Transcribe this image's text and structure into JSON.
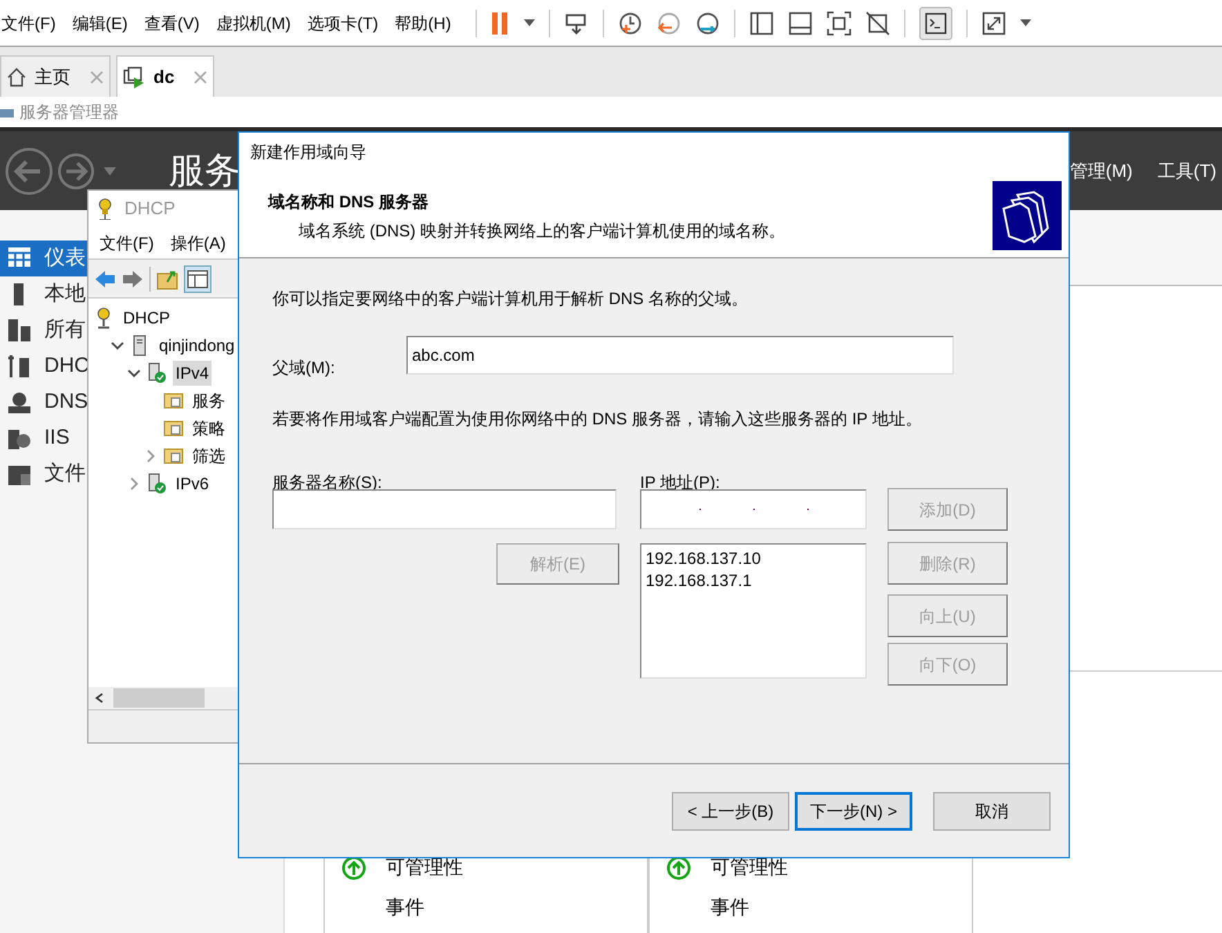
{
  "vm_menu": [
    "文件(F)",
    "编辑(E)",
    "查看(V)",
    "虚拟机(M)",
    "选项卡(T)",
    "帮助(H)"
  ],
  "vm_tabs": [
    {
      "label": "主页",
      "selected": false
    },
    {
      "label": "dc",
      "selected": true
    }
  ],
  "breadcrumb": "服务器管理器",
  "server_manager": {
    "title": "服务",
    "menus": [
      "管理(M)",
      "工具(T)"
    ],
    "sidebar": [
      {
        "label": "仪表",
        "selected": true
      },
      {
        "label": "本地",
        "selected": false
      },
      {
        "label": "所有",
        "selected": false
      },
      {
        "label": "DHC",
        "selected": false
      },
      {
        "label": "DNS",
        "selected": false
      },
      {
        "label": "IIS",
        "selected": false
      },
      {
        "label": "文件",
        "selected": false
      }
    ],
    "tiles": [
      {
        "status": "可管理性",
        "events": "事件"
      },
      {
        "status": "可管理性",
        "events": "事件"
      }
    ]
  },
  "dhcp_window": {
    "title": "DHCP",
    "menus": [
      "文件(F)",
      "操作(A)"
    ],
    "tree": [
      {
        "label": "DHCP",
        "kind": "root",
        "selected": false,
        "children": [
          {
            "label": "qinjindong",
            "kind": "server",
            "expanded": true,
            "selected": false,
            "children": [
              {
                "label": "IPv4",
                "kind": "protocol",
                "expanded": true,
                "selected": true,
                "children": [
                  {
                    "label": "服务",
                    "kind": "folder",
                    "selected": false
                  },
                  {
                    "label": "策略",
                    "kind": "folder",
                    "selected": false
                  },
                  {
                    "label": "筛选",
                    "kind": "folder",
                    "expanded": false,
                    "selected": false
                  }
                ]
              },
              {
                "label": "IPv6",
                "kind": "protocol",
                "expanded": false,
                "selected": false
              }
            ]
          }
        ]
      }
    ]
  },
  "wizard": {
    "title": "新建作用域向导",
    "heading": "域名称和 DNS 服务器",
    "subheading": "域名系统 (DNS) 映射并转换网络上的客户端计算机使用的域名称。",
    "intro": "你可以指定要网络中的客户端计算机用于解析 DNS 名称的父域。",
    "parent_domain": {
      "label": "父域(M):",
      "value": "abc.com"
    },
    "note": "若要将作用域客户端配置为使用你网络中的 DNS 服务器，请输入这些服务器的 IP 地址。",
    "server_name": {
      "label": "服务器名称(S):"
    },
    "ip_address": {
      "label": "IP 地址(P):"
    },
    "resolve_button": {
      "label": "解析(E)",
      "disabled": true
    },
    "ip_list": [
      "192.168.137.10",
      "192.168.137.1"
    ],
    "side_buttons": [
      {
        "label": "添加(D)",
        "disabled": true
      },
      {
        "label": "删除(R)",
        "disabled": true
      },
      {
        "label": "向上(U)",
        "disabled": true
      },
      {
        "label": "向下(O)",
        "disabled": true
      }
    ],
    "nav_buttons": [
      {
        "label": "< 上一步(B)",
        "default": false
      },
      {
        "label": "下一步(N) >",
        "default": true
      },
      {
        "label": "取消",
        "default": false
      }
    ]
  }
}
